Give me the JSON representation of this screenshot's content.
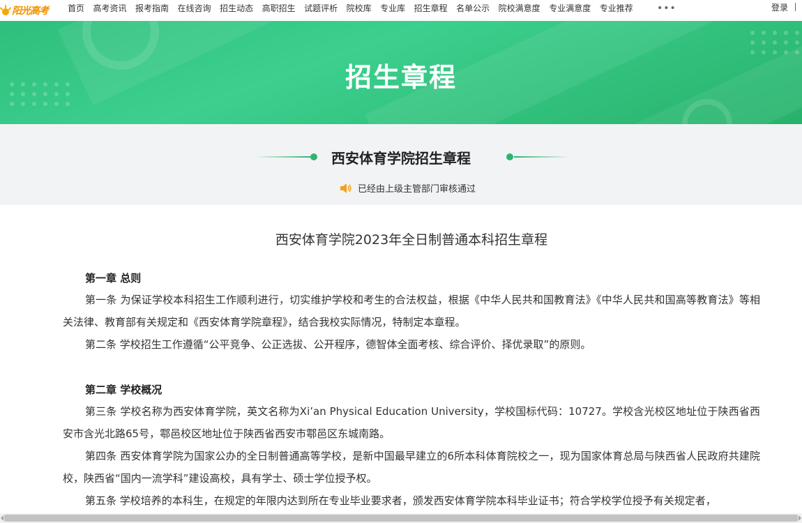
{
  "nav": {
    "logo_text": "阳光高考",
    "items": [
      "首页",
      "高考资讯",
      "报考指南",
      "在线咨询",
      "招生动态",
      "高职招生",
      "试题评析",
      "院校库",
      "专业库",
      "招生章程",
      "名单公示",
      "院校满意度",
      "专业满意度",
      "专业推荐"
    ],
    "more": "•••",
    "login": "登录"
  },
  "banner": {
    "title": "招生章程"
  },
  "header": {
    "school_title": "西安体育学院招生章程",
    "audit_text": "已经由上级主管部门审核通过"
  },
  "article": {
    "title": "西安体育学院2023年全日制普通本科招生章程",
    "chapter1": "第一章 总则",
    "p1": "第一条 为保证学校本科招生工作顺利进行，切实维护学校和考生的合法权益，根据《中华人民共和国教育法》《中华人民共和国高等教育法》等相关法律、教育部有关规定和《西安体育学院章程》，结合我校实际情况，特制定本章程。",
    "p2": "第二条 学校招生工作遵循“公平竞争、公正选拔、公开程序，德智体全面考核、综合评价、择优录取”的原则。",
    "chapter2": "第二章 学校概况",
    "p3": "第三条 学校名称为西安体育学院，英文名称为Xi’an Physical Education University，学校国标代码：10727。学校含光校区地址位于陕西省西安市含光北路65号，鄠邑校区地址位于陕西省西安市鄠邑区东城南路。",
    "p4": "第四条 西安体育学院为国家公办的全日制普通高等学校，是新中国最早建立的6所本科体育院校之一，现为国家体育总局与陕西省人民政府共建院校，陕西省“国内一流学科”建设高校，具有学士、硕士学位授予权。",
    "p5": "第五条 学校培养的本科生，在规定的年限内达到所在专业毕业要求者，颁发西安体育学院本科毕业证书；符合学校学位授予有关规定者，"
  }
}
